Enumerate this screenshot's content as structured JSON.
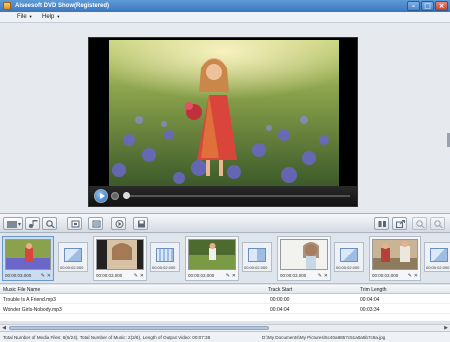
{
  "window": {
    "title": "Aiseesoft DVD Show(Registered)"
  },
  "menu": [
    {
      "label": "File"
    },
    {
      "label": "Help"
    }
  ],
  "storyboard": {
    "clips": [
      {
        "time": "00:00:03.000",
        "kind": "photo"
      },
      {
        "time": "00:00:03.000",
        "kind": "photo"
      },
      {
        "time": "00:00:03.000",
        "kind": "photo"
      },
      {
        "time": "00:00:03.000",
        "kind": "photo"
      },
      {
        "time": "00:00:03.000",
        "kind": "photo"
      }
    ],
    "transitions": [
      {
        "time": "00:00:02.000"
      },
      {
        "time": "00:00:02.000"
      },
      {
        "time": "00:00:02.000"
      },
      {
        "time": "00:00:02.000"
      },
      {
        "time": "00:00:02.000"
      }
    ]
  },
  "music": {
    "columns": [
      "Music File Name",
      "Track Start",
      "Trim Length"
    ],
    "rows": [
      {
        "name": "Trouble Is A Friend.mp3",
        "start": "00:00:00",
        "length": "00:04:04"
      },
      {
        "name": "Wonder Girls-Nobody.mp3",
        "start": "00:04:04",
        "length": "00:03:34"
      }
    ]
  },
  "status": {
    "summary": "Total Number of Media Files: 6(6/24), Total Number of Music: 2(2/6), Length of Output Video: 00:07:38",
    "path": "D:\\My Documents\\My Pictures\\5c40a8857c51a0a5b7c8a.jpg"
  },
  "colors": {
    "title_bar": "#3a76bf",
    "accent": "#5d9ad6"
  }
}
